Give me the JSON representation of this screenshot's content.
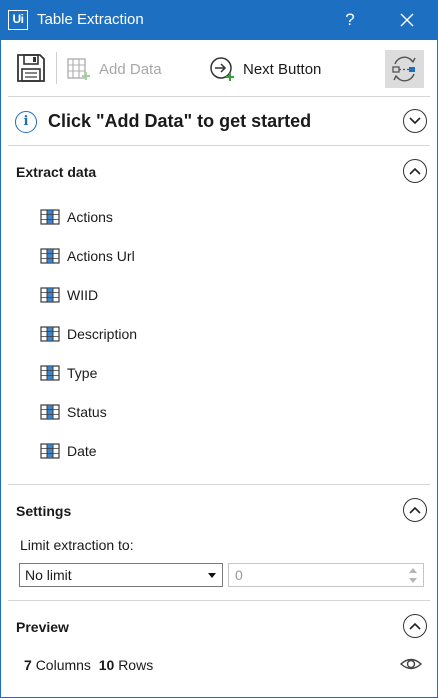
{
  "window": {
    "logo": "Ui",
    "title": "Table Extraction",
    "help": "?",
    "icons": {
      "close": "close-icon"
    }
  },
  "toolbar": {
    "save_icon": "save-icon",
    "add_data_label": "Add Data",
    "next_button_label": "Next Button",
    "refresh_icon": "refresh-icon"
  },
  "info": {
    "icon": "info-icon",
    "text": "Click \"Add Data\" to get started"
  },
  "extract": {
    "title": "Extract data",
    "fields": [
      "Actions",
      "Actions Url",
      "WIID",
      "Description",
      "Type",
      "Status",
      "Date"
    ]
  },
  "settings": {
    "title": "Settings",
    "limit_label": "Limit extraction to:",
    "limit_selected": "No limit",
    "limit_value": "0"
  },
  "preview": {
    "title": "Preview",
    "columns_count": "7",
    "columns_label": "Columns",
    "rows_count": "10",
    "rows_label": "Rows"
  },
  "colors": {
    "accent": "#1c6fc1",
    "disabled_text": "#a8a8a8",
    "divider": "#d5d5d5"
  }
}
